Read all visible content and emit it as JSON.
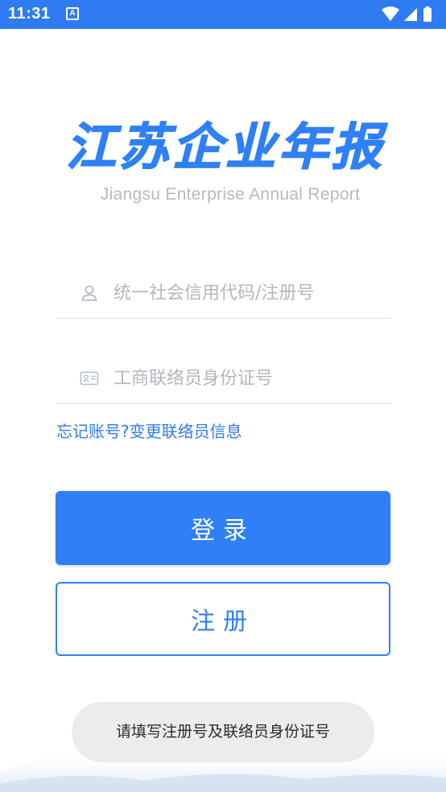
{
  "status_bar": {
    "time": "11:31",
    "app_icon_letter": "A"
  },
  "logo": {
    "title": "江苏企业年报",
    "subtitle": "Jiangsu Enterprise Annual Report"
  },
  "form": {
    "credit_code_placeholder": "统一社会信用代码/注册号",
    "id_number_placeholder": "工商联络员身份证号"
  },
  "links": {
    "forgot_account": "忘记账号?",
    "change_contact": "变更联络员信息"
  },
  "buttons": {
    "login": "登录",
    "register": "注册"
  },
  "toast": {
    "message": "请填写注册号及联络员身份证号"
  },
  "colors": {
    "brand_blue": "#2f80f6",
    "status_bar": "#2f7bf1"
  }
}
